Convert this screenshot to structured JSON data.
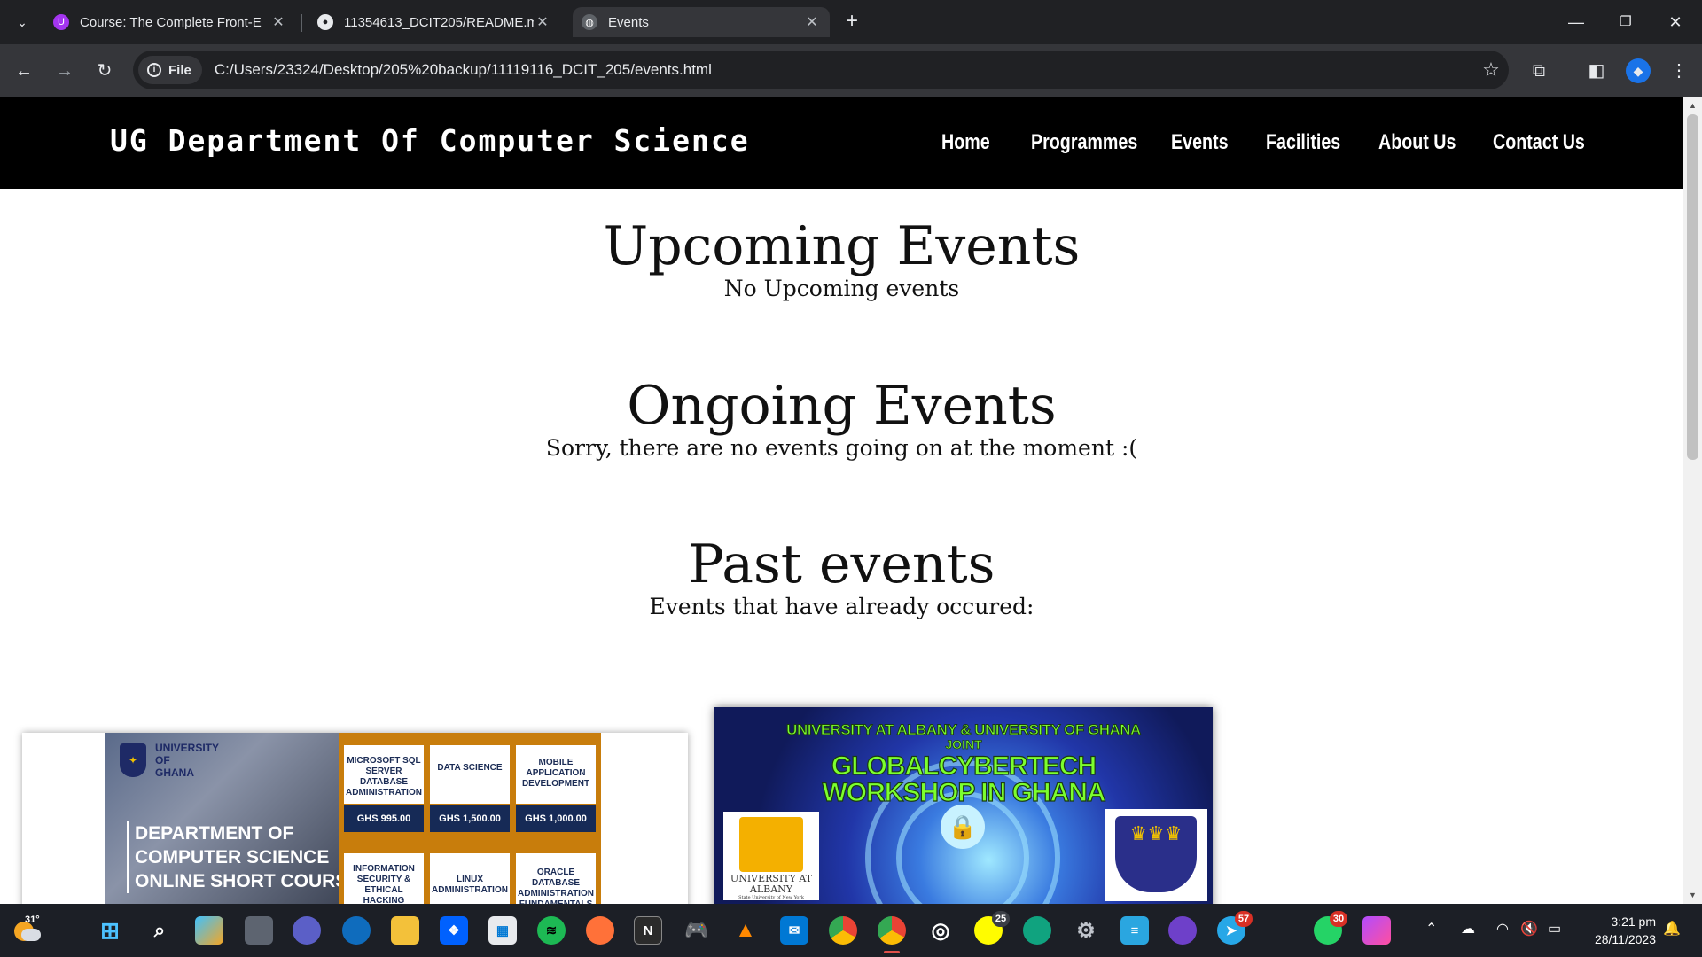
{
  "browser": {
    "tabs": [
      {
        "title": "Course: The Complete Front-E",
        "favicon": "udemy-icon",
        "active": false
      },
      {
        "title": "11354613_DCIT205/README.m",
        "favicon": "github-icon",
        "active": false
      },
      {
        "title": "Events",
        "favicon": "globe-icon",
        "active": true
      }
    ],
    "url_chip": "File",
    "url": "C:/Users/23324/Desktop/205%20backup/11119116_DCIT_205/events.html"
  },
  "site": {
    "brand": "UG Department Of Computer Science",
    "nav": [
      "Home",
      "Programmes",
      "Events",
      "Facilities",
      "About Us",
      "Contact Us"
    ]
  },
  "upcoming": {
    "heading": "Upcoming Events",
    "text": "No Upcoming events"
  },
  "ongoing": {
    "heading": "Ongoing Events",
    "text": "Sorry, there are no events going on at the moment :("
  },
  "past": {
    "heading": "Past events",
    "text": "Events that have already occured:"
  },
  "poster1": {
    "logo_text": "UNIVERSITY OF GHANA",
    "title_lines": [
      "DEPARTMENT OF",
      "COMPUTER SCIENCE",
      "ONLINE SHORT COURSES"
    ],
    "courses": [
      {
        "name": "MICROSOFT SQL SERVER DATABASE ADMINISTRATION",
        "price": "GHS 995.00"
      },
      {
        "name": "DATA SCIENCE",
        "price": "GHS 1,500.00"
      },
      {
        "name": "MOBILE APPLICATION DEVELOPMENT",
        "price": "GHS 1,000.00"
      },
      {
        "name": "INFORMATION SECURITY & ETHICAL HACKING",
        "price": ""
      },
      {
        "name": "LINUX ADMINISTRATION",
        "price": ""
      },
      {
        "name": "ORACLE DATABASE ADMINISTRATION FUNDAMENTALS",
        "price": ""
      }
    ]
  },
  "poster2": {
    "line1": "UNIVERSITY AT ALBANY & UNIVERSITY OF GHANA",
    "line2": "JOINT",
    "line3": "GLOBALCYBERTECH",
    "line4": "WORKSHOP IN GHANA",
    "albany_name": "UNIVERSITY AT ALBANY",
    "albany_sub": "State University of New York"
  },
  "taskbar": {
    "weather_temp": "31°",
    "badges": {
      "whatsapp": "30",
      "telegram": "57",
      "snapchat": "25"
    },
    "time": "3:21 pm",
    "date": "28/11/2023"
  },
  "colors": {
    "header_bg": "#000000",
    "page_bg": "#ffffff",
    "chrome_dark": "#202124",
    "toolbar": "#35363a"
  }
}
